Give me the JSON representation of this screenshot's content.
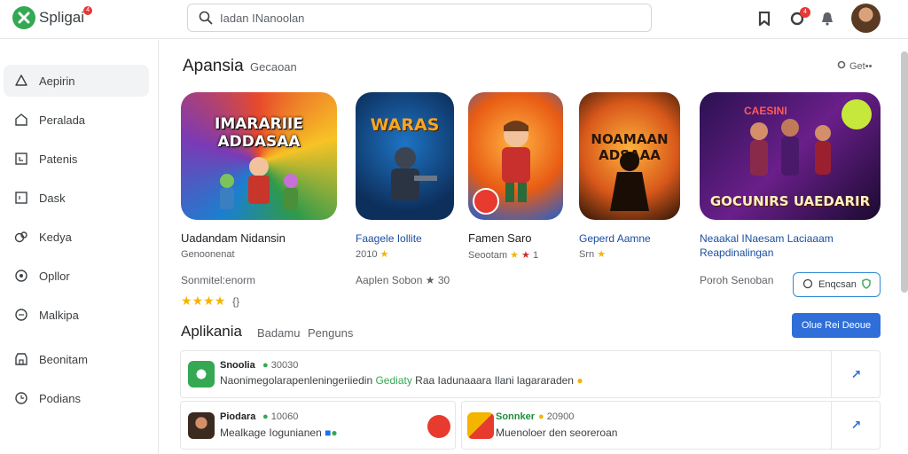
{
  "header": {
    "app_name": "Spligai",
    "logo_badge": "4",
    "search_placeholder": "Iadan INanoolan",
    "notif_count": "4"
  },
  "sidebar": {
    "items": [
      {
        "label": "Aepirin",
        "icon": "person-icon",
        "active": true
      },
      {
        "label": "Peralada",
        "icon": "home-icon"
      },
      {
        "label": "Patenis",
        "icon": "square-icon"
      },
      {
        "label": "Dask",
        "icon": "box-icon"
      },
      {
        "label": "Kedya",
        "icon": "bag-icon"
      },
      {
        "label": "Opllor",
        "icon": "circle-icon"
      },
      {
        "label": "Malkipa",
        "icon": "chat-icon"
      },
      {
        "label": "Beonitam",
        "icon": "store-icon"
      },
      {
        "label": "Podians",
        "icon": "clock-icon"
      }
    ]
  },
  "featured": {
    "title": "Apansia",
    "subtitle": "Gecaoan",
    "more_label": "Get••",
    "apps": [
      {
        "tile_text": "IMARARIIE ADDASAA",
        "name": "Uadandam Nidansin",
        "meta": "Genoonenat",
        "rating_text": "{}",
        "stars": 4
      },
      {
        "tile_text": "WARAS",
        "name": "Faagele Iollite",
        "meta": "2010",
        "meta2": "Aaplen Sobon",
        "rating": "30"
      },
      {
        "tile_text": "",
        "name": "Famen Saro",
        "meta": "Seootam",
        "rating": "1"
      },
      {
        "tile_text": "NOAMAAN ADSAAA",
        "name": "Geperd Aamne",
        "meta": "Srn"
      },
      {
        "tile_text": "GOCUNIRS UAEDARIR",
        "top_text": "CAESINI",
        "name": "Neaakal INaesam Laciaaam",
        "name2": "Reapdinalingan",
        "meta": "Poroh Senoban"
      }
    ],
    "sub_label_left": "Sonmitel:enorm",
    "outline_button": "Enqcsan",
    "primary_button": "Olue Rei Deoue"
  },
  "apps_section": {
    "title": "Aplikania",
    "tab1": "Badamu",
    "tab2": "Penguns",
    "rows": [
      {
        "title": "Snoolia",
        "id": "30030",
        "desc": "Naonimegolarapenleningeriiedin",
        "desc_hl": "Gediaty",
        "desc2": "Raa Iadunaaara Ilani lagararaden"
      },
      {
        "title": "Piodara",
        "id": "10060",
        "desc": "Mealkage Iogunianen"
      },
      {
        "title": "Sonnker",
        "id": "20900",
        "desc": "Muenoloer den seoreroan"
      }
    ]
  },
  "colors": {
    "accent": "#2f6ed8",
    "star": "#f4b400",
    "brand": "#34a853"
  }
}
